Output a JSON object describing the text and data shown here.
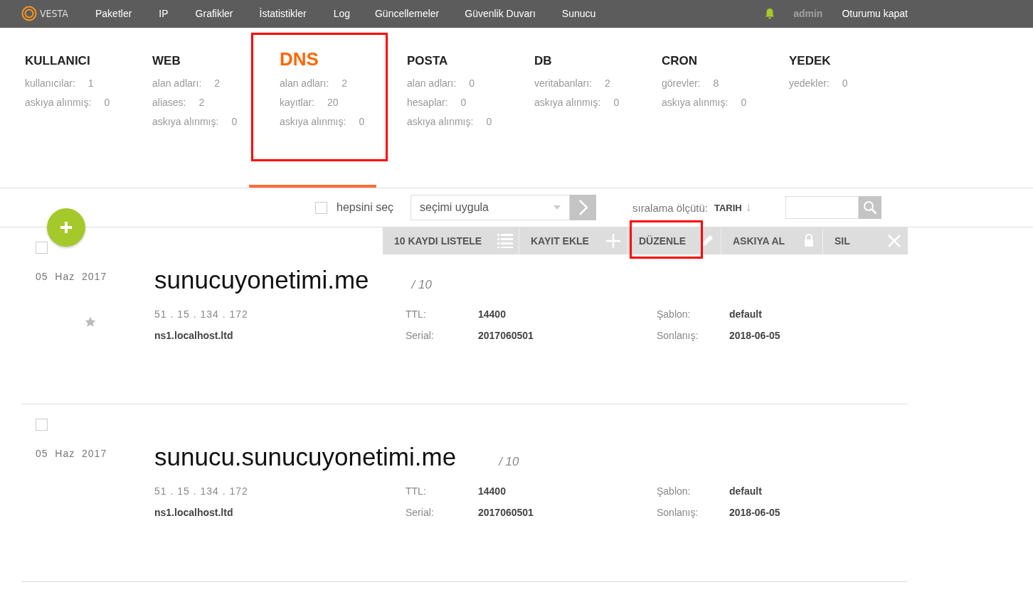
{
  "topbar": {
    "logo": "VESTA",
    "nav": [
      {
        "label": "Paketler",
        "selected": false
      },
      {
        "label": "IP",
        "selected": false
      },
      {
        "label": "Grafikler",
        "selected": false
      },
      {
        "label": "İstatistikler",
        "selected": false
      },
      {
        "label": "Log",
        "selected": false
      },
      {
        "label": "Güncellemeler",
        "selected": false
      },
      {
        "label": "Güvenlik Duvarı",
        "selected": false
      },
      {
        "label": "Sunucu",
        "selected": false
      }
    ],
    "user": "admin",
    "logout": "Oturumu kapat"
  },
  "stats": [
    {
      "title": "KULLANICI",
      "selected": false,
      "highlighted": false,
      "items": [
        {
          "label": "kullanıcılar:",
          "value": "1"
        },
        {
          "label": "askıya alınmış:",
          "value": "0"
        }
      ]
    },
    {
      "title": "WEB",
      "selected": false,
      "highlighted": false,
      "items": [
        {
          "label": "alan adları:",
          "value": "2"
        },
        {
          "label": "aliases:",
          "value": "2"
        },
        {
          "label": "askıya alınmış:",
          "value": "0"
        }
      ]
    },
    {
      "title": "DNS",
      "selected": true,
      "highlighted": true,
      "items": [
        {
          "label": "alan adları:",
          "value": "2"
        },
        {
          "label": "kayıtlar:",
          "value": "20"
        },
        {
          "label": "askıya alınmış:",
          "value": "0"
        }
      ]
    },
    {
      "title": "POSTA",
      "selected": false,
      "highlighted": false,
      "items": [
        {
          "label": "alan adları:",
          "value": "0"
        },
        {
          "label": "hesaplar:",
          "value": "0"
        },
        {
          "label": "askıya alınmış:",
          "value": "0"
        }
      ]
    },
    {
      "title": "DB",
      "selected": false,
      "highlighted": false,
      "items": [
        {
          "label": "veritabanları:",
          "value": "2"
        },
        {
          "label": "askıya alınmış:",
          "value": "0"
        }
      ]
    },
    {
      "title": "CRON",
      "selected": false,
      "highlighted": false,
      "items": [
        {
          "label": "görevler:",
          "value": "8"
        },
        {
          "label": "askıya alınmış:",
          "value": "0"
        }
      ]
    },
    {
      "title": "YEDEK",
      "selected": false,
      "highlighted": false,
      "items": [
        {
          "label": "yedekler:",
          "value": "0"
        }
      ]
    }
  ],
  "toolbar": {
    "select_all": {
      "label": "hepsini seç",
      "checked": false
    },
    "bulk_action": {
      "value": "seçimi uygula"
    },
    "sort": {
      "label": "sıralama ölçütü:",
      "value": "TARIH",
      "arrow": "↓"
    }
  },
  "actions": [
    {
      "label": "10 KAYDI LISTELE",
      "kind": "list",
      "highlighted": false
    },
    {
      "label": "KAYIT EKLE",
      "kind": "add",
      "highlighted": false
    },
    {
      "label": "DÜZENLE",
      "kind": "edit",
      "highlighted": true
    },
    {
      "label": "ASKIYA AL",
      "kind": "lock",
      "highlighted": false
    },
    {
      "label": "SIL",
      "kind": "delete",
      "highlighted": false
    }
  ],
  "domains": [
    {
      "checked": false,
      "date": "05  Haz  2017",
      "name": "sunucuyonetimi.me",
      "count": "/ 10",
      "starred": true,
      "ip": "51 . 15 . 134 . 172",
      "ns": "ns1.localhost.ltd",
      "details": [
        {
          "label": "TTL:",
          "value": "14400"
        },
        {
          "label": "Serial:",
          "value": "2017060501"
        },
        {
          "label": "Şablon:",
          "value": "default"
        },
        {
          "label": "Sonlanış:",
          "value": "2018-06-05"
        }
      ]
    },
    {
      "checked": false,
      "date": "05  Haz  2017",
      "name": "sunucu.sunucuyonetimi.me",
      "count": "/ 10",
      "starred": false,
      "ip": "51 . 15 . 134 . 172",
      "ns": "ns1.localhost.ltd",
      "details": [
        {
          "label": "TTL:",
          "value": "14400"
        },
        {
          "label": "Serial:",
          "value": "2017060501"
        },
        {
          "label": "Şablon:",
          "value": "default"
        },
        {
          "label": "Sonlanış:",
          "value": "2018-06-05"
        }
      ]
    }
  ]
}
